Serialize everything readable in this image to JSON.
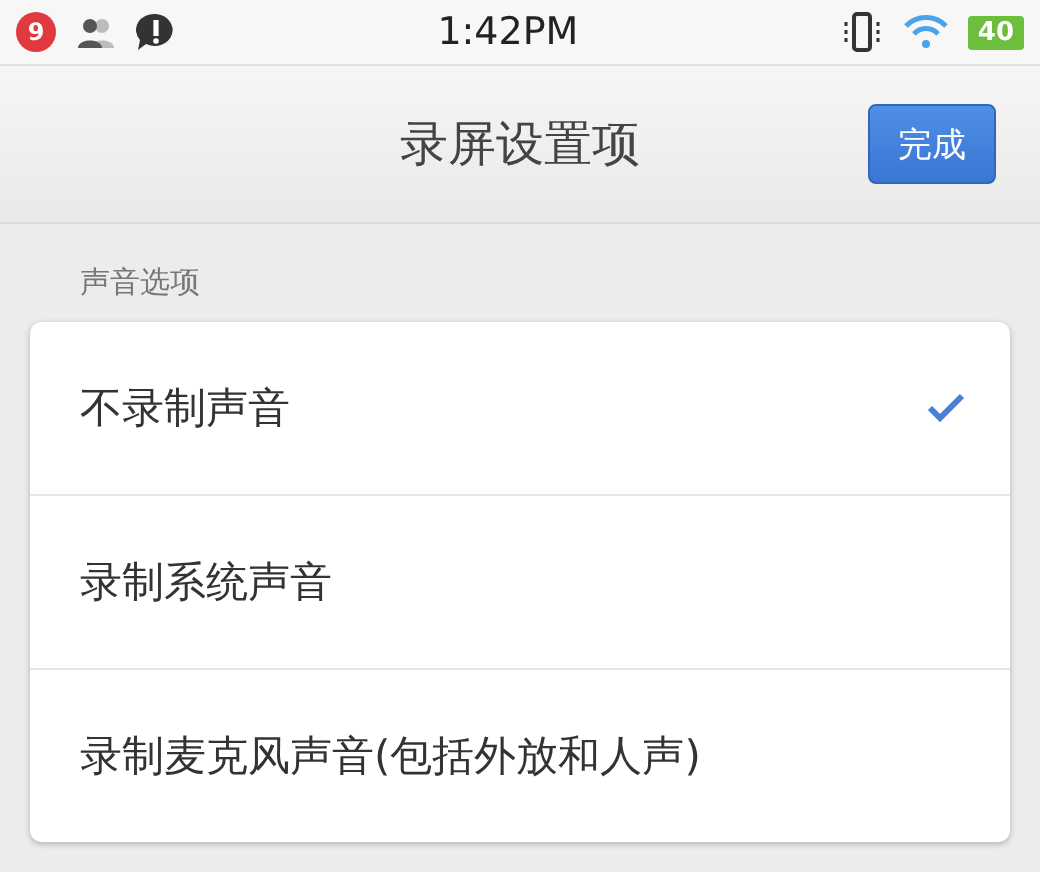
{
  "status_bar": {
    "notification_count": "9",
    "time": "1:42PM",
    "battery": "40"
  },
  "header": {
    "title": "录屏设置项",
    "done_button": "完成"
  },
  "section": {
    "label": "声音选项",
    "options": [
      {
        "label": "不录制声音",
        "selected": true
      },
      {
        "label": "录制系统声音",
        "selected": false
      },
      {
        "label": "录制麦克风声音(包括外放和人声)",
        "selected": false
      }
    ]
  }
}
